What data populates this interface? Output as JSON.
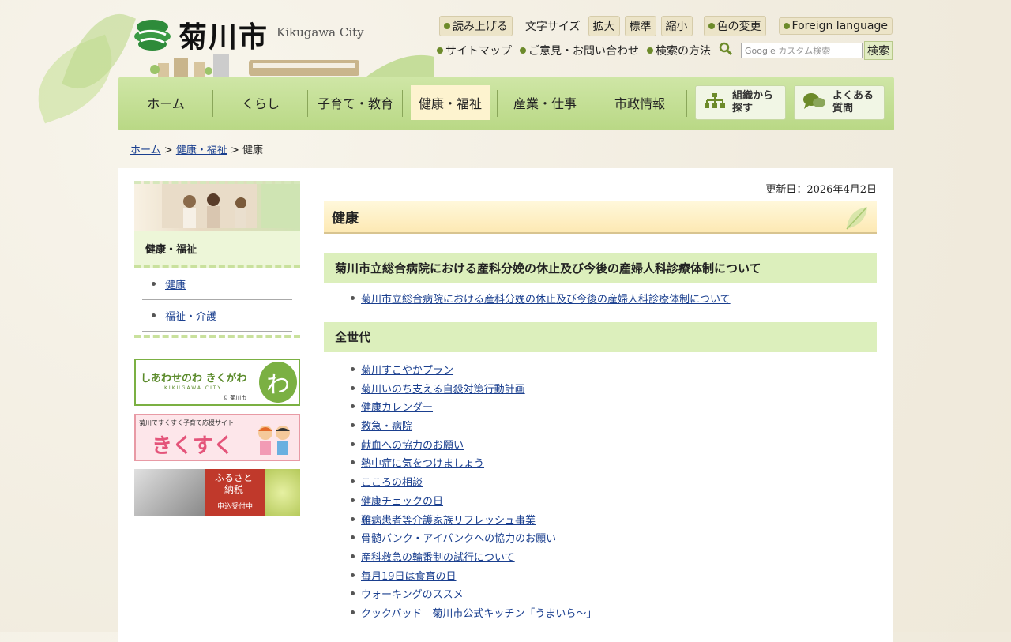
{
  "header": {
    "logo_text": "菊川市",
    "logo_sub": "Kikugawa City",
    "read_aloud": "読み上げる",
    "font_size_label": "文字サイズ",
    "font_sizes": [
      "拡大",
      "標準",
      "縮小"
    ],
    "color_change": "色の変更",
    "foreign": "Foreign language",
    "sitemap": "サイトマップ",
    "contact": "ご意見・お問い合わせ",
    "search_method": "検索の方法",
    "search_placeholder": "カスタム検索",
    "search_button": "検索"
  },
  "nav": {
    "items": [
      "ホーム",
      "くらし",
      "子育て・教育",
      "健康・福祉",
      "産業・仕事",
      "市政情報"
    ],
    "active_index": 3,
    "org_button": [
      "組織から",
      "探す"
    ],
    "faq_button": [
      "よくある",
      "質問"
    ]
  },
  "breadcrumb": {
    "home": "ホーム",
    "sep": ">",
    "parent": "健康・福祉",
    "current": "健康"
  },
  "sidebar": {
    "title": "健康・福祉",
    "items": [
      "健康",
      "福祉・介護"
    ],
    "banners": [
      {
        "text": "しあわせのわ きくがわ",
        "sub": "KIKUGAWA CITY",
        "credit": "© 菊川市"
      },
      {
        "text": "きくすく",
        "sub": "菊川ですくすく子育て応援サイト"
      },
      {
        "text": "ふるさと 納税",
        "sub": "申込受付中"
      }
    ]
  },
  "main": {
    "updated": "更新日：2026年4月2日",
    "title": "健康",
    "sections": [
      {
        "heading": "菊川市立総合病院における産科分娩の休止及び今後の産婦人科診療体制について",
        "links": [
          "菊川市立総合病院における産科分娩の休止及び今後の産婦人科診療体制について"
        ]
      },
      {
        "heading": "全世代",
        "links": [
          "菊川すこやかプラン",
          "菊川いのち支える自殺対策行動計画",
          "健康カレンダー",
          "救急・病院",
          "献血への協力のお願い",
          "熱中症に気をつけましょう",
          "こころの相談",
          "健康チェックの日",
          "難病患者等介護家族リフレッシュ事業",
          "骨髄バンク・アイバンクへの協力のお願い",
          "産科救急の輪番制の試行について",
          "毎月19日は食育の日",
          "ウォーキングのススメ",
          "クックパッド　菊川市公式キッチン「うまいら～」"
        ]
      }
    ]
  },
  "colors": {
    "nav_green": "#b9d885",
    "active_tab": "#fdf3cf",
    "section_green": "#dcefbc",
    "link_blue": "#1a3f8f"
  }
}
